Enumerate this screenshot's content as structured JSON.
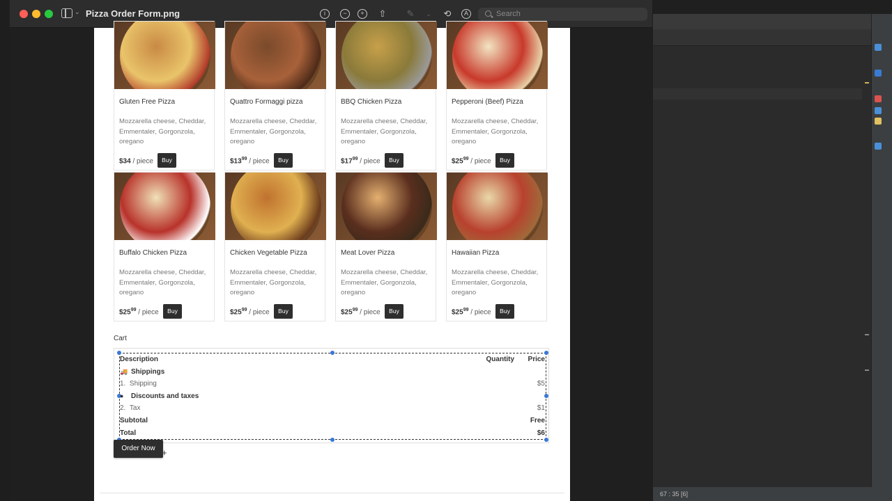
{
  "window": {
    "title": "Pizza Order Form.png",
    "search_placeholder": "Search"
  },
  "ide": {
    "status": "67 : 35 [6]"
  },
  "products": [
    {
      "name": "Gluten Free Pizza",
      "desc": "Mozzarella cheese, Cheddar, Emmentaler, Gorgonzola, oregano",
      "price_main": "$34",
      "price_cents": "",
      "unit": "/ piece",
      "buy": "Buy",
      "palette": [
        "#c98a45",
        "#e9c46a",
        "#b23a2a"
      ]
    },
    {
      "name": "Quattro Formaggi pizza",
      "desc": "Mozzarella cheese, Cheddar, Emmentaler, Gorgonzola, oregano",
      "price_main": "$13",
      "price_cents": "99",
      "unit": "/ piece",
      "buy": "Buy",
      "palette": [
        "#7a4a2b",
        "#a8613a",
        "#4d2a18"
      ]
    },
    {
      "name": "BBQ Chicken Pizza",
      "desc": "Mozzarella cheese, Cheddar, Emmentaler, Gorgonzola, oregano",
      "price_main": "$17",
      "price_cents": "99",
      "unit": "/ piece",
      "buy": "Buy",
      "palette": [
        "#c7a04a",
        "#8a7a3a",
        "#9a9a9a"
      ]
    },
    {
      "name": "Pepperoni (Beef) Pizza",
      "desc": "Mozzarella cheese, Cheddar, Emmentaler, Gorgonzola, oregano",
      "price_main": "$25",
      "price_cents": "99",
      "unit": "/ piece",
      "buy": "Buy",
      "palette": [
        "#f2e4c2",
        "#c8392b",
        "#e8d2a8"
      ]
    },
    {
      "name": "Buffalo Chicken Pizza",
      "desc": "Mozzarella cheese, Cheddar, Emmentaler, Gorgonzola, oregano",
      "price_main": "$25",
      "price_cents": "99",
      "unit": "/ piece",
      "buy": "Buy",
      "palette": [
        "#f0e1b8",
        "#b8322a",
        "#ffffff"
      ]
    },
    {
      "name": "Chicken Vegetable Pizza",
      "desc": "Mozzarella cheese, Cheddar, Emmentaler, Gorgonzola, oregano",
      "price_main": "$25",
      "price_cents": "99",
      "unit": "/ piece",
      "buy": "Buy",
      "palette": [
        "#c0722f",
        "#e0b050",
        "#6b3b1c"
      ]
    },
    {
      "name": "Meat Lover Pizza",
      "desc": "Mozzarella cheese, Cheddar, Emmentaler, Gorgonzola, oregano",
      "price_main": "$25",
      "price_cents": "99",
      "unit": "/ piece",
      "buy": "Buy",
      "palette": [
        "#e4b070",
        "#5a2e1e",
        "#3a2a1a"
      ]
    },
    {
      "name": "Hawaiian Pizza",
      "desc": "Mozzarella cheese, Cheddar, Emmentaler, Gorgonzola, oregano",
      "price_main": "$25",
      "price_cents": "99",
      "unit": "/ piece",
      "buy": "Buy",
      "palette": [
        "#e9d8a8",
        "#b8412e",
        "#a06a3a"
      ]
    }
  ],
  "cart": {
    "label": "Cart",
    "header": {
      "description": "Description",
      "quantity": "Quantity",
      "price": "Price"
    },
    "shippings_title": "Shippings",
    "shipping": {
      "num": "1.",
      "label": "Shipping",
      "price": "$5"
    },
    "discounts_title": "Discounts and taxes",
    "tax": {
      "num": "2.",
      "label": "Tax",
      "price": "$1"
    },
    "subtotal": {
      "label": "Subtotal",
      "value": "Free"
    },
    "total": {
      "label": "Total",
      "value": "$6"
    }
  },
  "order_button": "Order Now"
}
